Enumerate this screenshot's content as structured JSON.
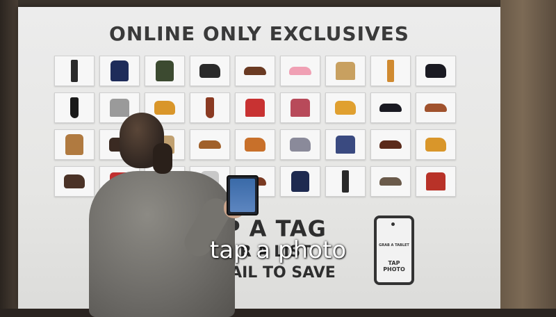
{
  "wall": {
    "title": "ONLINE ONLY EXCLUSIVES",
    "cta_line1": "P A TAG",
    "cta_line2": "R A LIST",
    "cta_line3": "MAIL TO SAVE",
    "tablet_icon_line1": "GRAB A TABLET",
    "tablet_icon_line2": "TAP PHOTO"
  },
  "caption": "tap a photo",
  "colors": {
    "wall": "#e8e8e6",
    "frame_dark": "#333333",
    "caption_text": "#ffffff"
  },
  "products": [
    [
      "pants",
      "#2a2a2a"
    ],
    [
      "jacket",
      "#1e2c5a"
    ],
    [
      "jacket",
      "#3c4a30"
    ],
    [
      "boot",
      "#2a2a2a"
    ],
    [
      "shoe",
      "#6a3a22"
    ],
    [
      "shoe",
      "#f0a0b4"
    ],
    [
      "shirt",
      "#c8a060"
    ],
    [
      "pants",
      "#d08a30"
    ],
    [
      "boot",
      "#1a1a22"
    ],
    [
      "tallboot",
      "#1a1a1a"
    ],
    [
      "shirt",
      "#9a9a9a"
    ],
    [
      "boot",
      "#d9962a"
    ],
    [
      "tallboot",
      "#8a3a22"
    ],
    [
      "shirt",
      "#c83232"
    ],
    [
      "shirt",
      "#b84a5a"
    ],
    [
      "boot",
      "#e0a030"
    ],
    [
      "shoe",
      "#1a1a22"
    ],
    [
      "shoe",
      "#a0522d"
    ],
    [
      "jacket",
      "#b07a40"
    ],
    [
      "boot",
      "#3a2a22"
    ],
    [
      "shirt",
      "#c0a070"
    ],
    [
      "shoe",
      "#a0602a"
    ],
    [
      "boot",
      "#c8702a"
    ],
    [
      "boot",
      "#8a8a9a"
    ],
    [
      "shirt",
      "#3a4a80"
    ],
    [
      "shoe",
      "#5a2a1a"
    ],
    [
      "boot",
      "#d9962a"
    ],
    [
      "boot",
      "#4a3226"
    ],
    [
      "shirt",
      "#c03030"
    ],
    [
      "boot",
      "#d08a2a"
    ],
    [
      "jacket",
      "#c8c8c8"
    ],
    [
      "shoe",
      "#7a3a22"
    ],
    [
      "jacket",
      "#1e2a50"
    ],
    [
      "pants",
      "#2a2a2a"
    ],
    [
      "shoe",
      "#6a5a4a"
    ],
    [
      "shirt",
      "#b83228"
    ]
  ]
}
